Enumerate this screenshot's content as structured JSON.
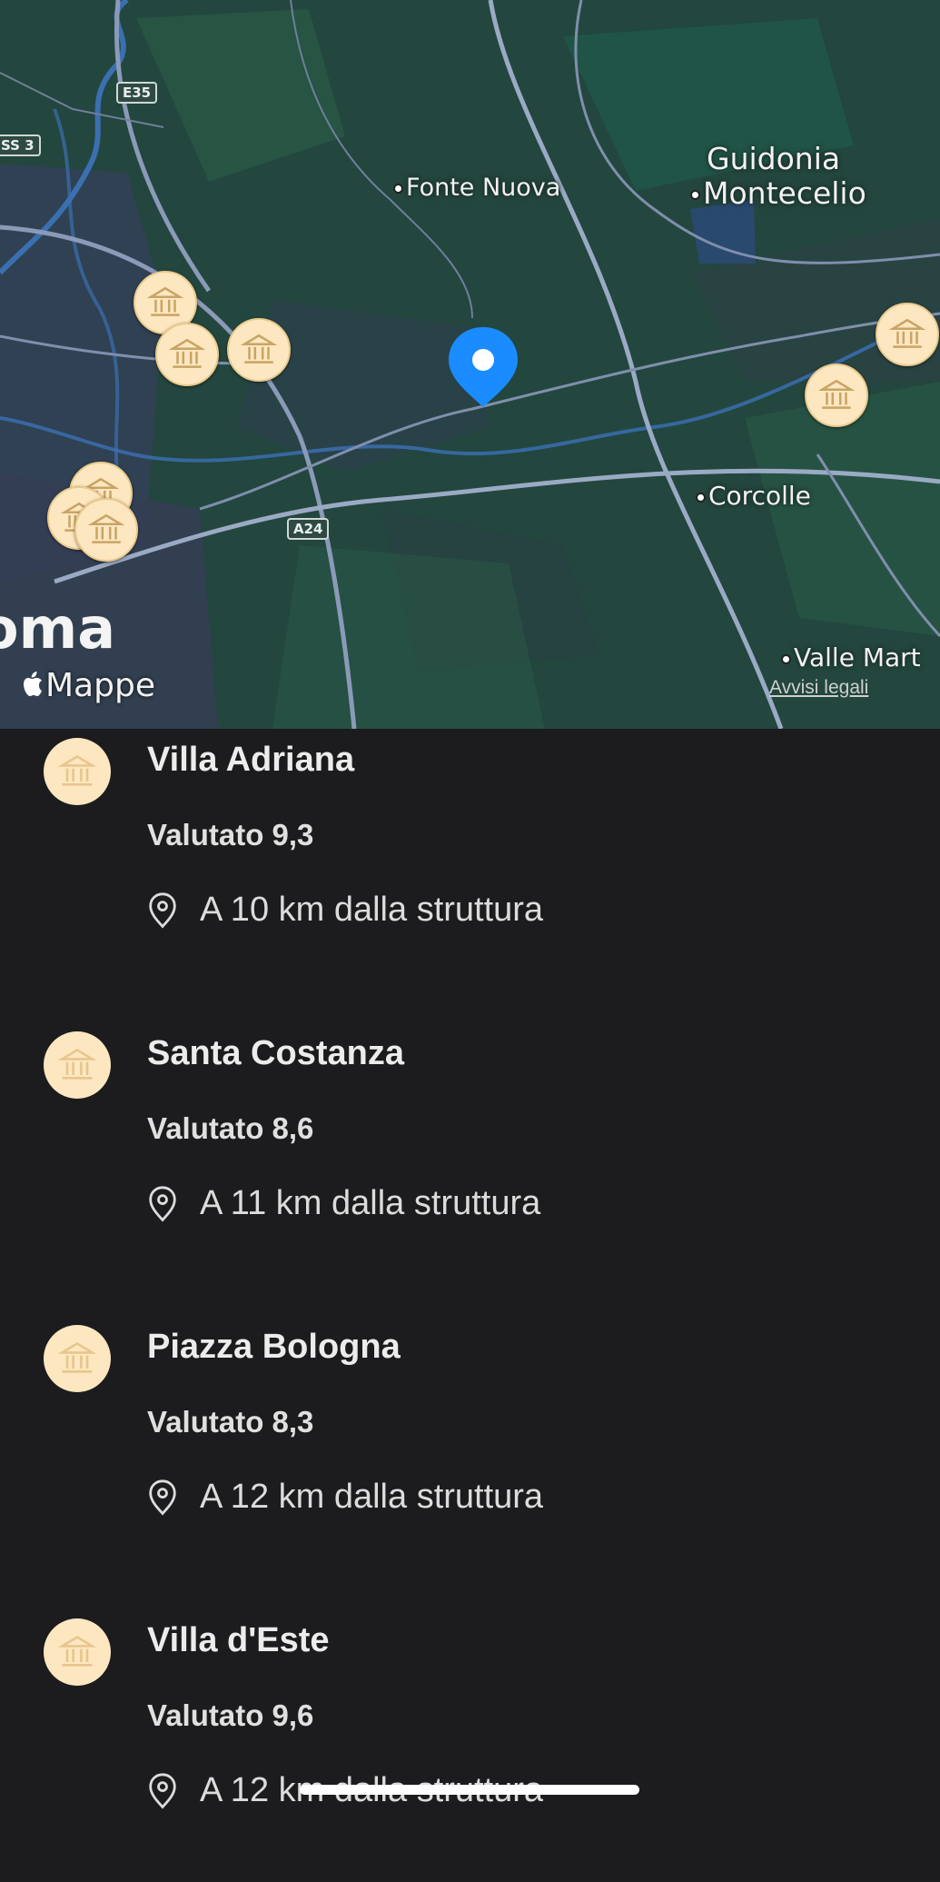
{
  "map": {
    "places": {
      "fonte_nuova": "Fonte Nuova",
      "guidonia_line1": "Guidonia",
      "guidonia_line2": "Montecelio",
      "corcolle": "Corcolle",
      "valle_mart": "Valle Mart",
      "roma": "oma"
    },
    "roads": {
      "e35": "E35",
      "ss3": "SS 3",
      "a24": "A24"
    },
    "watermark": "Mappe",
    "legal": "Avvisi legali",
    "colors": {
      "land": "#23463e",
      "pin": "#1a8cff",
      "poi": "#fde7c0"
    }
  },
  "list": {
    "items": [
      {
        "name": "Villa Adriana",
        "rating": "Valutato 9,3",
        "distance": "A 10 km dalla struttura",
        "icon": "museum-icon"
      },
      {
        "name": "Santa Costanza",
        "rating": "Valutato 8,6",
        "distance": "A 11 km dalla struttura",
        "icon": "museum-icon"
      },
      {
        "name": "Piazza Bologna",
        "rating": "Valutato 8,3",
        "distance": "A 12 km dalla struttura",
        "icon": "museum-icon"
      },
      {
        "name": "Villa d'Este",
        "rating": "Valutato 9,6",
        "distance": "A 12 km dalla struttura",
        "icon": "museum-icon"
      }
    ]
  }
}
